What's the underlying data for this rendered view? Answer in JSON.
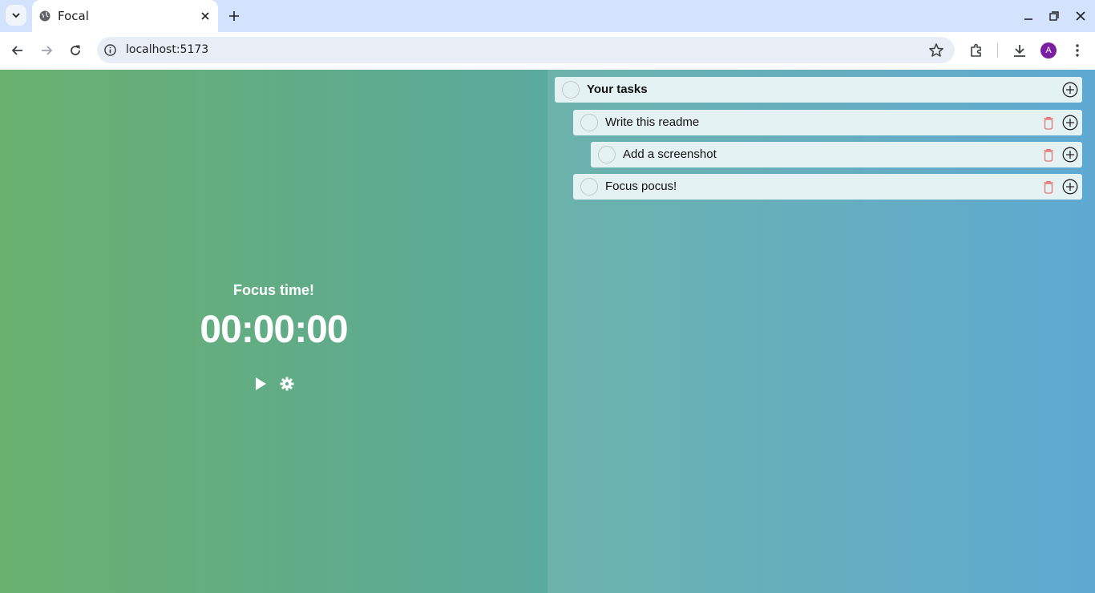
{
  "browser": {
    "tab_title": "Focal",
    "url": "localhost:5173",
    "profile_initial": "A"
  },
  "timer": {
    "heading": "Focus time!",
    "time": "00:00:00"
  },
  "tasks": {
    "root_label": "Your tasks",
    "items": [
      {
        "label": "Write this readme",
        "depth": 1
      },
      {
        "label": "Add a screenshot",
        "depth": 2
      },
      {
        "label": "Focus pocus!",
        "depth": 1
      }
    ]
  },
  "colors": {
    "delete_icon": "#e57373",
    "avatar": "#7b1fa2"
  }
}
